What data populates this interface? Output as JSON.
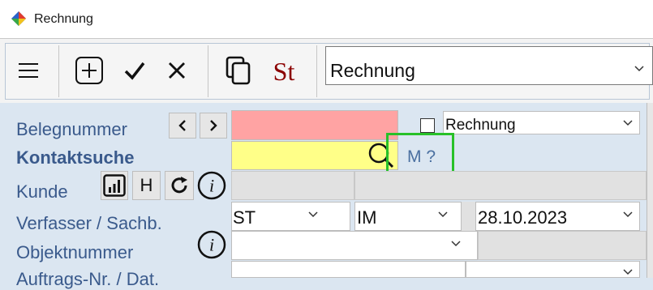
{
  "window": {
    "title": "Rechnung"
  },
  "toolbar": {
    "menu_icon": "hamburger-icon",
    "new_icon": "plus-square-icon",
    "confirm_icon": "check-icon",
    "cancel_icon": "x-icon",
    "copy_icon": "copy-icon",
    "st_label": "St",
    "doc_type_select": "Rechnung"
  },
  "form": {
    "labels": {
      "belegnummer": "Belegnummer",
      "kontaktsuche": "Kontaktsuche",
      "kunde": "Kunde",
      "verfasser": "Verfasser / Sachb.",
      "objektnummer": "Objektnummer",
      "auftrags": "Auftrags-Nr. / Dat."
    },
    "h_button": "H",
    "info_icon_glyph": "i",
    "rechnung_dropdown": "Rechnung",
    "contact_search_hint": "M ?",
    "verfasser_select": "ST",
    "sachb_select": "IM",
    "date_select": "28.10.2023"
  },
  "colors": {
    "belegnummer_field": "#ffa3a3",
    "kontaktsuche_field": "#ffff88",
    "label_blue": "#3a5a8c",
    "highlight_green": "#28c128",
    "st_red": "#8b0000"
  }
}
